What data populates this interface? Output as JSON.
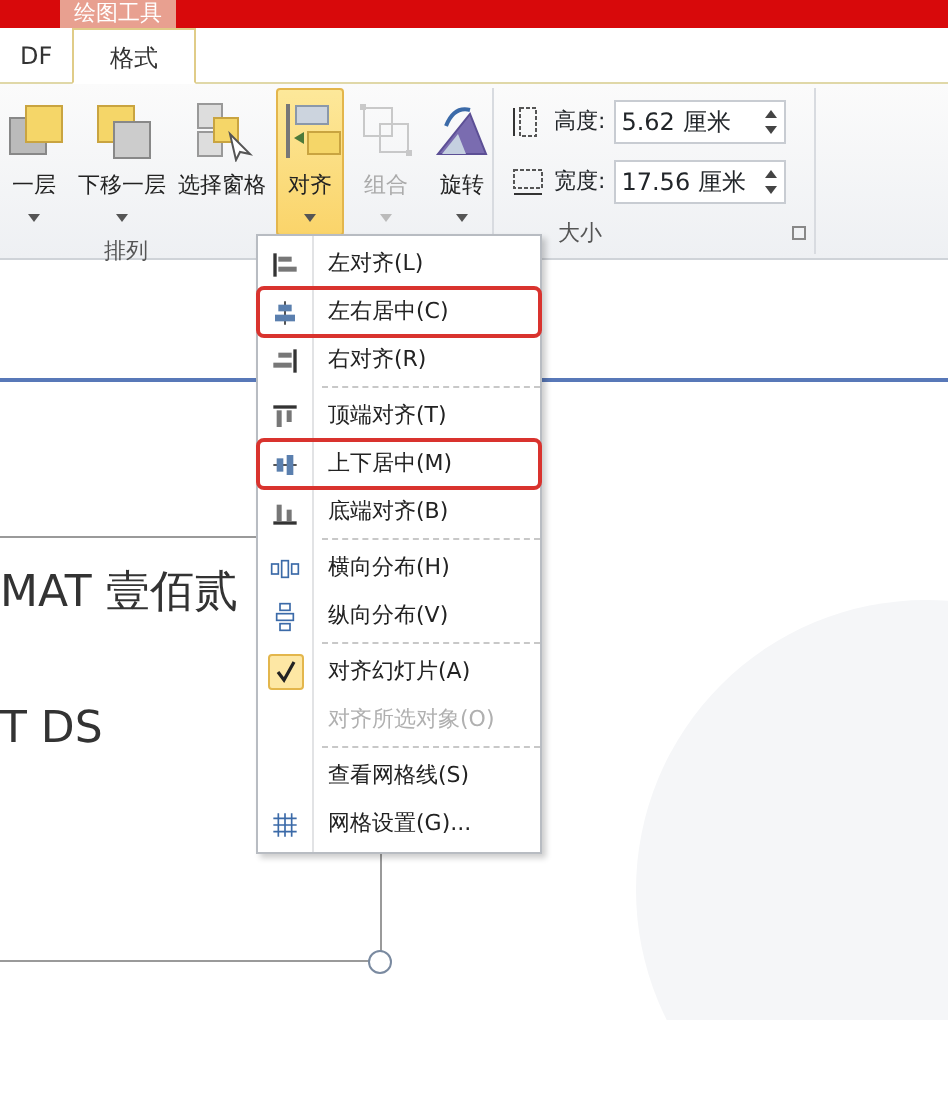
{
  "contextual_tab": "绘图工具",
  "tabs": [
    {
      "label": "DF",
      "selected": false
    },
    {
      "label": "格式",
      "selected": true
    }
  ],
  "arrange_group": {
    "label": "排列",
    "buttons": [
      {
        "label": "一层",
        "active": false,
        "disabled": false,
        "dropdown": true
      },
      {
        "label": "下移一层",
        "active": false,
        "disabled": false,
        "dropdown": true
      },
      {
        "label": "选择窗格",
        "active": false,
        "disabled": false,
        "dropdown": false
      },
      {
        "label": "对齐",
        "active": true,
        "disabled": false,
        "dropdown": true
      },
      {
        "label": "组合",
        "active": false,
        "disabled": true,
        "dropdown": true
      },
      {
        "label": "旋转",
        "active": false,
        "disabled": false,
        "dropdown": true
      }
    ]
  },
  "size_group": {
    "label": "大小",
    "fields": [
      {
        "label": "高度:",
        "value": "5.62 厘米"
      },
      {
        "label": "宽度:",
        "value": "17.56 厘米"
      }
    ]
  },
  "align_menu": [
    {
      "kind": "item",
      "label": "左对齐(L)",
      "checked": false,
      "disabled": false,
      "highlighted": false
    },
    {
      "kind": "item",
      "label": "左右居中(C)",
      "checked": false,
      "disabled": false,
      "highlighted": true
    },
    {
      "kind": "item",
      "label": "右对齐(R)",
      "checked": false,
      "disabled": false,
      "highlighted": false
    },
    {
      "kind": "separator"
    },
    {
      "kind": "item",
      "label": "顶端对齐(T)",
      "checked": false,
      "disabled": false,
      "highlighted": false
    },
    {
      "kind": "item",
      "label": "上下居中(M)",
      "checked": false,
      "disabled": false,
      "highlighted": true
    },
    {
      "kind": "item",
      "label": "底端对齐(B)",
      "checked": false,
      "disabled": false,
      "highlighted": false
    },
    {
      "kind": "separator"
    },
    {
      "kind": "item",
      "label": "横向分布(H)",
      "checked": false,
      "disabled": false,
      "highlighted": false
    },
    {
      "kind": "item",
      "label": "纵向分布(V)",
      "checked": false,
      "disabled": false,
      "highlighted": false
    },
    {
      "kind": "separator"
    },
    {
      "kind": "item",
      "label": "对齐幻灯片(A)",
      "checked": true,
      "disabled": false,
      "highlighted": false
    },
    {
      "kind": "item",
      "label": "对齐所选对象(O)",
      "checked": false,
      "disabled": true,
      "highlighted": false
    },
    {
      "kind": "separator"
    },
    {
      "kind": "item",
      "label": "查看网格线(S)",
      "checked": false,
      "disabled": false,
      "highlighted": false
    },
    {
      "kind": "item",
      "label": "网格设置(G)...",
      "checked": false,
      "disabled": false,
      "highlighted": false
    }
  ],
  "slide": {
    "texts": [
      "MAT 壹佰贰",
      "T DS"
    ]
  }
}
